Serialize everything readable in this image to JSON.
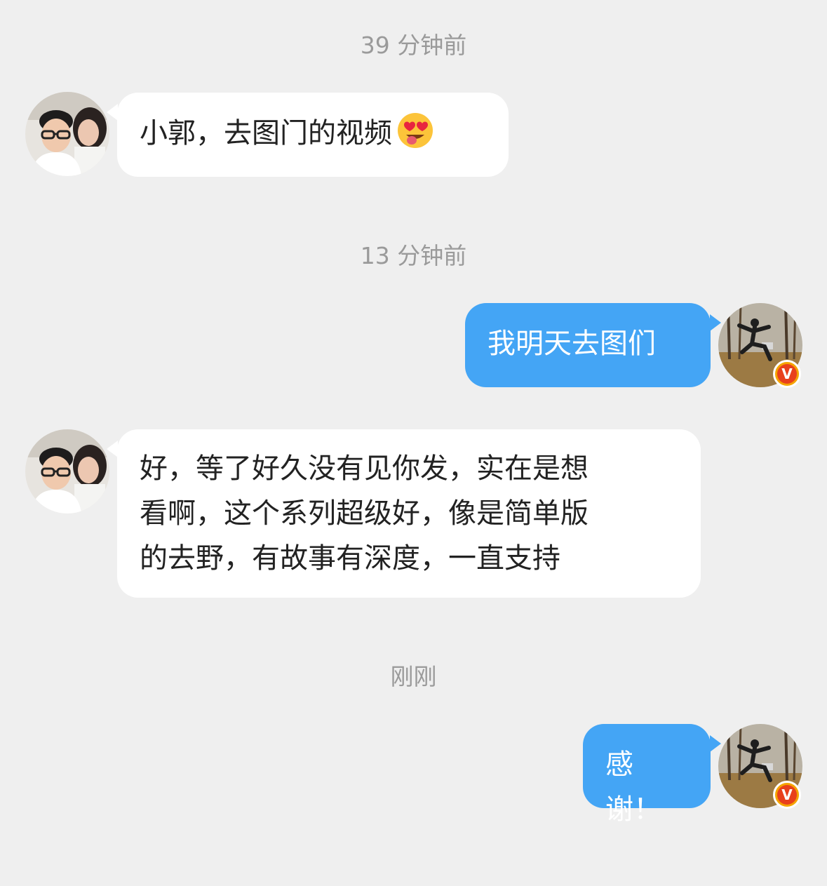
{
  "conversation": {
    "messages": [
      {
        "timestamp": "39 分钟前",
        "direction": "incoming",
        "text": "小郭，去图门的视频",
        "emoji": "heart-eyes-tongue-emoji"
      },
      {
        "timestamp": "13 分钟前",
        "direction": "outgoing",
        "text": "我明天去图们"
      },
      {
        "direction": "incoming",
        "lines": [
          "好，等了好久没有见你发，实在是想",
          "看啊，这个系列超级好，像是简单版",
          "的去野，有故事有深度，一直支持"
        ]
      },
      {
        "timestamp": "刚刚",
        "direction": "outgoing",
        "text": "感谢！"
      }
    ]
  },
  "badge_label": "V",
  "colors": {
    "background": "#efefef",
    "incoming_bubble": "#ffffff",
    "outgoing_bubble": "#44a5f5",
    "timestamp_text": "#9a9a9a",
    "verified_badge": "#f5a300"
  }
}
